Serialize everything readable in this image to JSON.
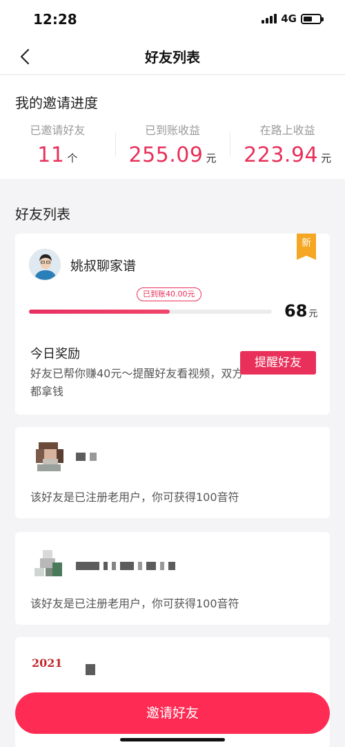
{
  "status_bar": {
    "time": "12:28",
    "network": "4G"
  },
  "nav": {
    "title": "好友列表"
  },
  "progress": {
    "title": "我的邀请进度",
    "stats": [
      {
        "label": "已邀请好友",
        "value": "11",
        "unit": "个"
      },
      {
        "label": "已到账收益",
        "value": "255.09",
        "unit": "元"
      },
      {
        "label": "在路上收益",
        "value": "223.94",
        "unit": "元"
      }
    ]
  },
  "friend_list": {
    "title": "好友列表",
    "featured": {
      "badge": "新",
      "name": "姚叔聊家谱",
      "earned_tag": "已到账40.00元",
      "progress_fraction": 0.58,
      "target_amount": "68",
      "target_unit": "元",
      "reward_title": "今日奖励",
      "reward_desc": "好友已帮你赚40元～提醒好友看视频，双方都拿钱",
      "remind_label": "提醒好友"
    },
    "others": [
      {
        "desc": "该好友是已注册老用户，你可获得100音符"
      },
      {
        "desc": "该好友是已注册老用户，你可获得100音符"
      },
      {
        "avatar_text": "2021"
      }
    ]
  },
  "invite_button": {
    "label": "邀请好友"
  },
  "colors": {
    "accent": "#e8305a",
    "button": "#fe2c55",
    "badge": "#f5a623"
  }
}
